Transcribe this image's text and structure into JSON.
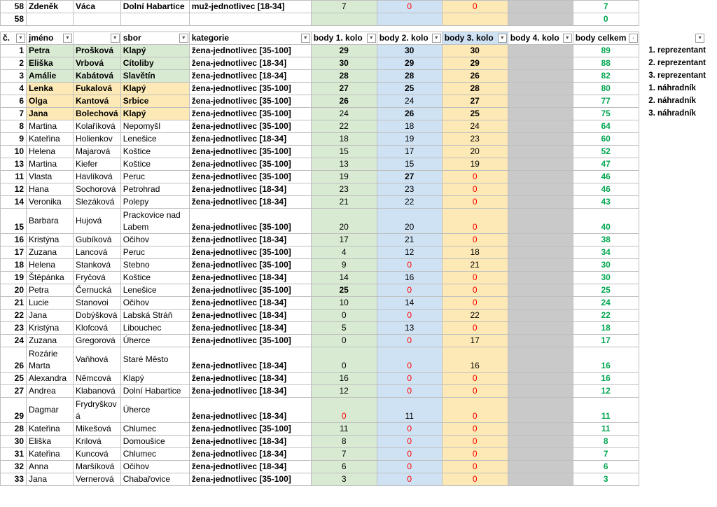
{
  "top_rows": [
    {
      "num": "58",
      "first": "Zdeněk",
      "last": "Váca",
      "club": "Dolní Habartice",
      "cat": "muž-jednotlivec [18-34]",
      "r1": "7",
      "r2": "0",
      "r3": "0",
      "r4": "",
      "tot": "7"
    },
    {
      "num": "58",
      "first": "",
      "last": "",
      "club": "",
      "cat": "",
      "r1": "",
      "r2": "",
      "r3": "",
      "r4": "",
      "tot": "0"
    }
  ],
  "headers": {
    "num": "č.",
    "first": "jméno",
    "last": "",
    "club": "sbor",
    "cat": "kategorie",
    "r1": "body 1. kolo",
    "r2": "body 2. kolo",
    "r3": "body 3. kolo",
    "r4": "body 4. kolo",
    "tot": "body celkem"
  },
  "rows": [
    {
      "num": "1",
      "first": "Petra",
      "last": "Prošková",
      "club": "Klapý",
      "cat": "žena-jednotlivec [35-100]",
      "r1": "29",
      "r2": "30",
      "r3": "30",
      "tot": "89",
      "note": "1. reprezentant",
      "hl": "top1",
      "b1": true,
      "b2": true,
      "b3": true
    },
    {
      "num": "2",
      "first": "Eliška",
      "last": "Vrbová",
      "club": "Cítoliby",
      "cat": "žena-jednotlivec [18-34]",
      "r1": "30",
      "r2": "29",
      "r3": "29",
      "tot": "88",
      "note": "2. reprezentant",
      "hl": "top1",
      "b1": true,
      "b2": true,
      "b3": true
    },
    {
      "num": "3",
      "first": "Amálie",
      "last": "Kabátová",
      "club": "Slavětín",
      "cat": "žena-jednotlivec [18-34]",
      "r1": "28",
      "r2": "28",
      "r3": "26",
      "tot": "82",
      "note": "3. reprezentant",
      "hl": "top1",
      "b1": true,
      "b2": true,
      "b3": true
    },
    {
      "num": "4",
      "first": "Lenka",
      "last": "Fukalová",
      "club": "Klapý",
      "cat": "žena-jednotlivec [35-100]",
      "r1": "27",
      "r2": "25",
      "r3": "28",
      "tot": "80",
      "note": "1. náhradník",
      "hl": "top2",
      "b1": true,
      "b2": true,
      "b3": true
    },
    {
      "num": "6",
      "first": "Olga",
      "last": "Kantová",
      "club": "Srbice",
      "cat": "žena-jednotlivec [35-100]",
      "r1": "26",
      "r2": "24",
      "r3": "27",
      "tot": "77",
      "note": "2. náhradník",
      "hl": "top2",
      "b1": true,
      "b3": true
    },
    {
      "num": "7",
      "first": "Jana",
      "last": "Bolechová",
      "club": "Klapý",
      "cat": "žena-jednotlivec [35-100]",
      "r1": "24",
      "r2": "26",
      "r3": "25",
      "tot": "75",
      "note": "3. náhradník",
      "hl": "top2",
      "b2": true,
      "b3": true
    },
    {
      "num": "8",
      "first": "Martina",
      "last": "Kolaříková",
      "club": "Nepomyšl",
      "cat": "žena-jednotlivec [35-100]",
      "r1": "22",
      "r2": "18",
      "r3": "24",
      "tot": "64"
    },
    {
      "num": "9",
      "first": "Kateřina",
      "last": "Holienkov",
      "club": "Lenešice",
      "cat": "žena-jednotlivec [18-34]",
      "r1": "18",
      "r2": "19",
      "r3": "23",
      "tot": "60"
    },
    {
      "num": "10",
      "first": "Helena",
      "last": "Majarová",
      "club": "Koštice",
      "cat": "žena-jednotlivec [35-100]",
      "r1": "15",
      "r2": "17",
      "r3": "20",
      "tot": "52"
    },
    {
      "num": "13",
      "first": "Martina",
      "last": "Kiefer",
      "club": "Koštice",
      "cat": "žena-jednotlivec [35-100]",
      "r1": "13",
      "r2": "15",
      "r3": "19",
      "tot": "47"
    },
    {
      "num": "11",
      "first": "Vlasta",
      "last": "Havlíková",
      "club": "Peruc",
      "cat": "žena-jednotlivec [35-100]",
      "r1": "19",
      "r2": "27",
      "r3": "0",
      "tot": "46",
      "b2": true
    },
    {
      "num": "12",
      "first": "Hana",
      "last": "Sochorová",
      "club": "Petrohrad",
      "cat": "žena-jednotlivec [18-34]",
      "r1": "23",
      "r2": "23",
      "r3": "0",
      "tot": "46"
    },
    {
      "num": "14",
      "first": "Veronika",
      "last": "Slezáková",
      "club": "Polepy",
      "cat": "žena-jednotlivec [18-34]",
      "r1": "21",
      "r2": "22",
      "r3": "0",
      "tot": "43"
    },
    {
      "num": "15",
      "first": "Barbara",
      "last": "Hujová",
      "club": "Prackovice nad Labem",
      "cat": "žena-jednotlivec [35-100]",
      "r1": "20",
      "r2": "20",
      "r3": "0",
      "tot": "40",
      "tall": true
    },
    {
      "num": "16",
      "first": "Kristýna",
      "last": "Gubíková",
      "club": "Očihov",
      "cat": "žena-jednotlivec [18-34]",
      "r1": "17",
      "r2": "21",
      "r3": "0",
      "tot": "38"
    },
    {
      "num": "17",
      "first": "Zuzana",
      "last": "Lancová",
      "club": "Peruc",
      "cat": "žena-jednotlivec [35-100]",
      "r1": "4",
      "r2": "12",
      "r3": "18",
      "tot": "34"
    },
    {
      "num": "18",
      "first": "Helena",
      "last": "Stanková",
      "club": "Stebno",
      "cat": "žena-jednotlivec [35-100]",
      "r1": "9",
      "r2": "0",
      "r3": "21",
      "tot": "30"
    },
    {
      "num": "19",
      "first": "Štěpánka",
      "last": "Fryčová",
      "club": "Koštice",
      "cat": "žena-jednotlivec [18-34]",
      "r1": "14",
      "r2": "16",
      "r3": "0",
      "tot": "30"
    },
    {
      "num": "20",
      "first": "Petra",
      "last": "Černucká",
      "club": "Lenešice",
      "cat": "žena-jednotlivec [35-100]",
      "r1": "25",
      "r2": "0",
      "r3": "0",
      "tot": "25",
      "b1": true
    },
    {
      "num": "21",
      "first": "Lucie",
      "last": "Stanovoi",
      "club": "Očihov",
      "cat": "žena-jednotlivec [18-34]",
      "r1": "10",
      "r2": "14",
      "r3": "0",
      "tot": "24"
    },
    {
      "num": "22",
      "first": "Jana",
      "last": "Dobýšková",
      "club": "Labská Stráň",
      "cat": "žena-jednotlivec [18-34]",
      "r1": "0",
      "r2": "0",
      "r3": "22",
      "tot": "22"
    },
    {
      "num": "23",
      "first": "Kristýna",
      "last": "Klofcová",
      "club": "Libouchec",
      "cat": "žena-jednotlivec [18-34]",
      "r1": "5",
      "r2": "13",
      "r3": "0",
      "tot": "18"
    },
    {
      "num": "24",
      "first": "Zuzana",
      "last": "Gregorová",
      "club": "Úherce",
      "cat": "žena-jednotlivec [35-100]",
      "r1": "0",
      "r2": "0",
      "r3": "17",
      "tot": "17"
    },
    {
      "num": "26",
      "first": "Rozárie Marta",
      "last": "Vaňhová",
      "club": "Staré Město",
      "cat": "žena-jednotlivec [18-34]",
      "r1": "0",
      "r2": "0",
      "r3": "16",
      "tot": "16",
      "tall": true
    },
    {
      "num": "25",
      "first": "Alexandra",
      "last": "Němcová",
      "club": "Klapý",
      "cat": "žena-jednotlivec [18-34]",
      "r1": "16",
      "r2": "0",
      "r3": "0",
      "tot": "16"
    },
    {
      "num": "27",
      "first": "Andrea",
      "last": "Klabanová",
      "club": "Dolní Habartice",
      "cat": "žena-jednotlivec [18-34]",
      "r1": "12",
      "r2": "0",
      "r3": "0",
      "tot": "12"
    },
    {
      "num": "29",
      "first": "Dagmar",
      "last": "Frydryškov á",
      "club": "Úherce",
      "cat": "žena-jednotlivec [18-34]",
      "r1": "0",
      "r2": "11",
      "r3": "0",
      "tot": "11",
      "tall": true,
      "r1red": true
    },
    {
      "num": "28",
      "first": "Kateřina",
      "last": "Mikešová",
      "club": "Chlumec",
      "cat": "žena-jednotlivec [35-100]",
      "r1": "11",
      "r2": "0",
      "r3": "0",
      "tot": "11"
    },
    {
      "num": "30",
      "first": "Eliška",
      "last": "Krilová",
      "club": "Domoušice",
      "cat": "žena-jednotlivec [18-34]",
      "r1": "8",
      "r2": "0",
      "r3": "0",
      "tot": "8"
    },
    {
      "num": "31",
      "first": "Kateřina",
      "last": "Kuncová",
      "club": "Chlumec",
      "cat": "žena-jednotlivec [18-34]",
      "r1": "7",
      "r2": "0",
      "r3": "0",
      "tot": "7"
    },
    {
      "num": "32",
      "first": "Anna",
      "last": "Maršíková",
      "club": "Očihov",
      "cat": "žena-jednotlivec [18-34]",
      "r1": "6",
      "r2": "0",
      "r3": "0",
      "tot": "6"
    },
    {
      "num": "33",
      "first": "Jana",
      "last": "Vernerová",
      "club": "Chabařovice",
      "cat": "žena-jednotlivec [35-100]",
      "r1": "3",
      "r2": "0",
      "r3": "0",
      "tot": "3"
    }
  ]
}
